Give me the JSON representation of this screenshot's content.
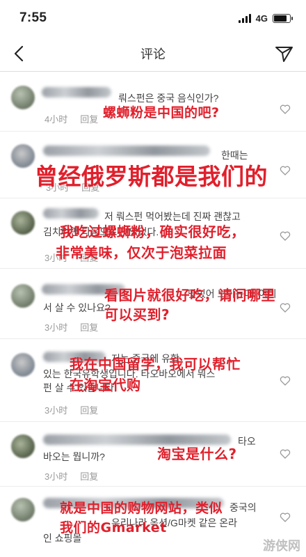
{
  "status_bar": {
    "time": "7:55",
    "network": "4G",
    "battery_level_pct": 90
  },
  "header": {
    "title": "评论"
  },
  "comments": [
    {
      "text": "뤄스펀은 중국 음식인가?",
      "time": "4小时",
      "reply": "回复",
      "overlay": "螺蛳粉是中国的吧?"
    },
    {
      "text": "한때는",
      "time": "3小时",
      "reply": "回复",
      "overlay": "曾经俄罗斯都是我们的"
    },
    {
      "text_line1": "저 뤄스펀 먹어봤는데 진짜 괜찮고",
      "text_line2": "김치라면 다음으로 맛있었다. ",
      "time": "3小时",
      "reply": "回复",
      "overlay_line1": "我吃过螺蛳粉，确实很好吃，",
      "overlay_line2": "非常美味，仅次于泡菜拉面"
    },
    {
      "text_line1": "맛있어 보이는데, 어디",
      "text_line2": "서 살 수 있나요?",
      "time": "3小时",
      "reply": "回复",
      "overlay_line1": "看图片就很好吃，请问哪里",
      "overlay_line2": "可以买到?"
    },
    {
      "text_line1": "저는 중국에 유학",
      "text_line2": "있는 한국유학생입니다. 타오바오에서 뭐스",
      "text_line3": "펀 살 수 있습니다.",
      "time": "3小时",
      "reply": "回复",
      "overlay_line1": "我在中国留学，我可以帮忙",
      "overlay_line2": "在淘宝代购"
    },
    {
      "text_line1": "타오",
      "text_line2": "바오는 뭡니까?",
      "time": "3小时",
      "reply": "回复",
      "overlay": "淘宝是什么?"
    },
    {
      "text_line1": "중국의",
      "text_line2": "우리나라 옥션/G마켓 같은 온라",
      "text_line3": "인 쇼핑몰",
      "overlay_line1": "就是中国的购物网站，类似",
      "overlay_line2": "我们的Gmarket"
    }
  ],
  "watermark": "游侠网"
}
